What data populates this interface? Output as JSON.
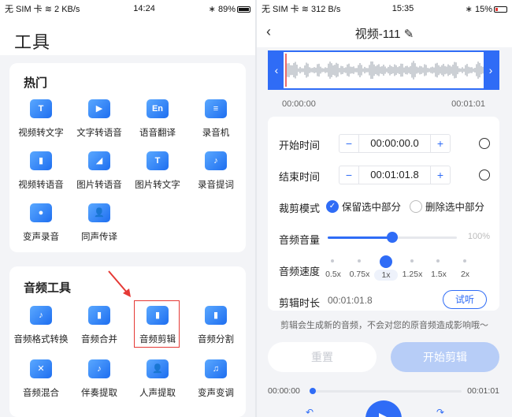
{
  "left": {
    "status": {
      "carrier": "无 SIM 卡",
      "speed": "2 KB/s",
      "time": "14:24",
      "battery": "89%"
    },
    "title": "工具",
    "hot_section": {
      "title": "热门",
      "items": [
        {
          "label": "视频转文字",
          "icon": "video-text-icon",
          "glyph": "T"
        },
        {
          "label": "文字转语音",
          "icon": "text-audio-icon",
          "glyph": "▶"
        },
        {
          "label": "语音翻译",
          "icon": "translate-icon",
          "glyph": "En"
        },
        {
          "label": "录音机",
          "icon": "recorder-icon",
          "glyph": "≡"
        },
        {
          "label": "视频转语音",
          "icon": "video-audio-icon",
          "glyph": "▮"
        },
        {
          "label": "图片转语音",
          "icon": "image-audio-icon",
          "glyph": "◢"
        },
        {
          "label": "图片转文字",
          "icon": "image-text-icon",
          "glyph": "T"
        },
        {
          "label": "录音提词",
          "icon": "prompter-icon",
          "glyph": "♪"
        },
        {
          "label": "变声录音",
          "icon": "voice-change-icon",
          "glyph": "●"
        },
        {
          "label": "同声传译",
          "icon": "interpret-icon",
          "glyph": "👤"
        }
      ]
    },
    "audio_section": {
      "title": "音频工具",
      "items": [
        {
          "label": "音频格式转换",
          "icon": "format-convert-icon",
          "glyph": "♪"
        },
        {
          "label": "音频合并",
          "icon": "audio-merge-icon",
          "glyph": "▮"
        },
        {
          "label": "音频剪辑",
          "icon": "audio-clip-icon",
          "glyph": "▮"
        },
        {
          "label": "音频分割",
          "icon": "audio-split-icon",
          "glyph": "▮"
        },
        {
          "label": "音频混合",
          "icon": "audio-mix-icon",
          "glyph": "✕"
        },
        {
          "label": "伴奏提取",
          "icon": "accompaniment-icon",
          "glyph": "♪"
        },
        {
          "label": "人声提取",
          "icon": "vocal-extract-icon",
          "glyph": "👤"
        },
        {
          "label": "变声变调",
          "icon": "pitch-change-icon",
          "glyph": "♫"
        }
      ]
    }
  },
  "right": {
    "status": {
      "carrier": "无 SIM 卡",
      "speed": "312 B/s",
      "time": "15:35",
      "battery": "15%"
    },
    "title": "视频-111",
    "wave_start": "00:00:00",
    "wave_end": "00:01:01",
    "start_label": "开始时间",
    "start_value": "00:00:00.0",
    "end_label": "结束时间",
    "end_value": "00:01:01.8",
    "mode_label": "裁剪模式",
    "mode_keep": "保留选中部分",
    "mode_delete": "删除选中部分",
    "mode_selected": "keep",
    "volume_label": "音频音量",
    "volume_value": "100%",
    "volume_level": 0.5,
    "speed_label": "音频速度",
    "speed_options": [
      "0.5x",
      "0.75x",
      "1x",
      "1.25x",
      "1.5x",
      "2x"
    ],
    "speed_selected": "1x",
    "duration_label": "剪辑时长",
    "duration_value": "00:01:01.8",
    "listen_label": "试听",
    "hint": "剪辑会生成新的音频，不会对您的原音频造成影响哦～",
    "reset_label": "重置",
    "start_clip_label": "开始剪辑",
    "play_start": "00:00:00",
    "play_end": "00:01:01",
    "play_progress": 0.0
  },
  "colors": {
    "accent": "#2f6cf6",
    "highlight": "#e53935"
  }
}
